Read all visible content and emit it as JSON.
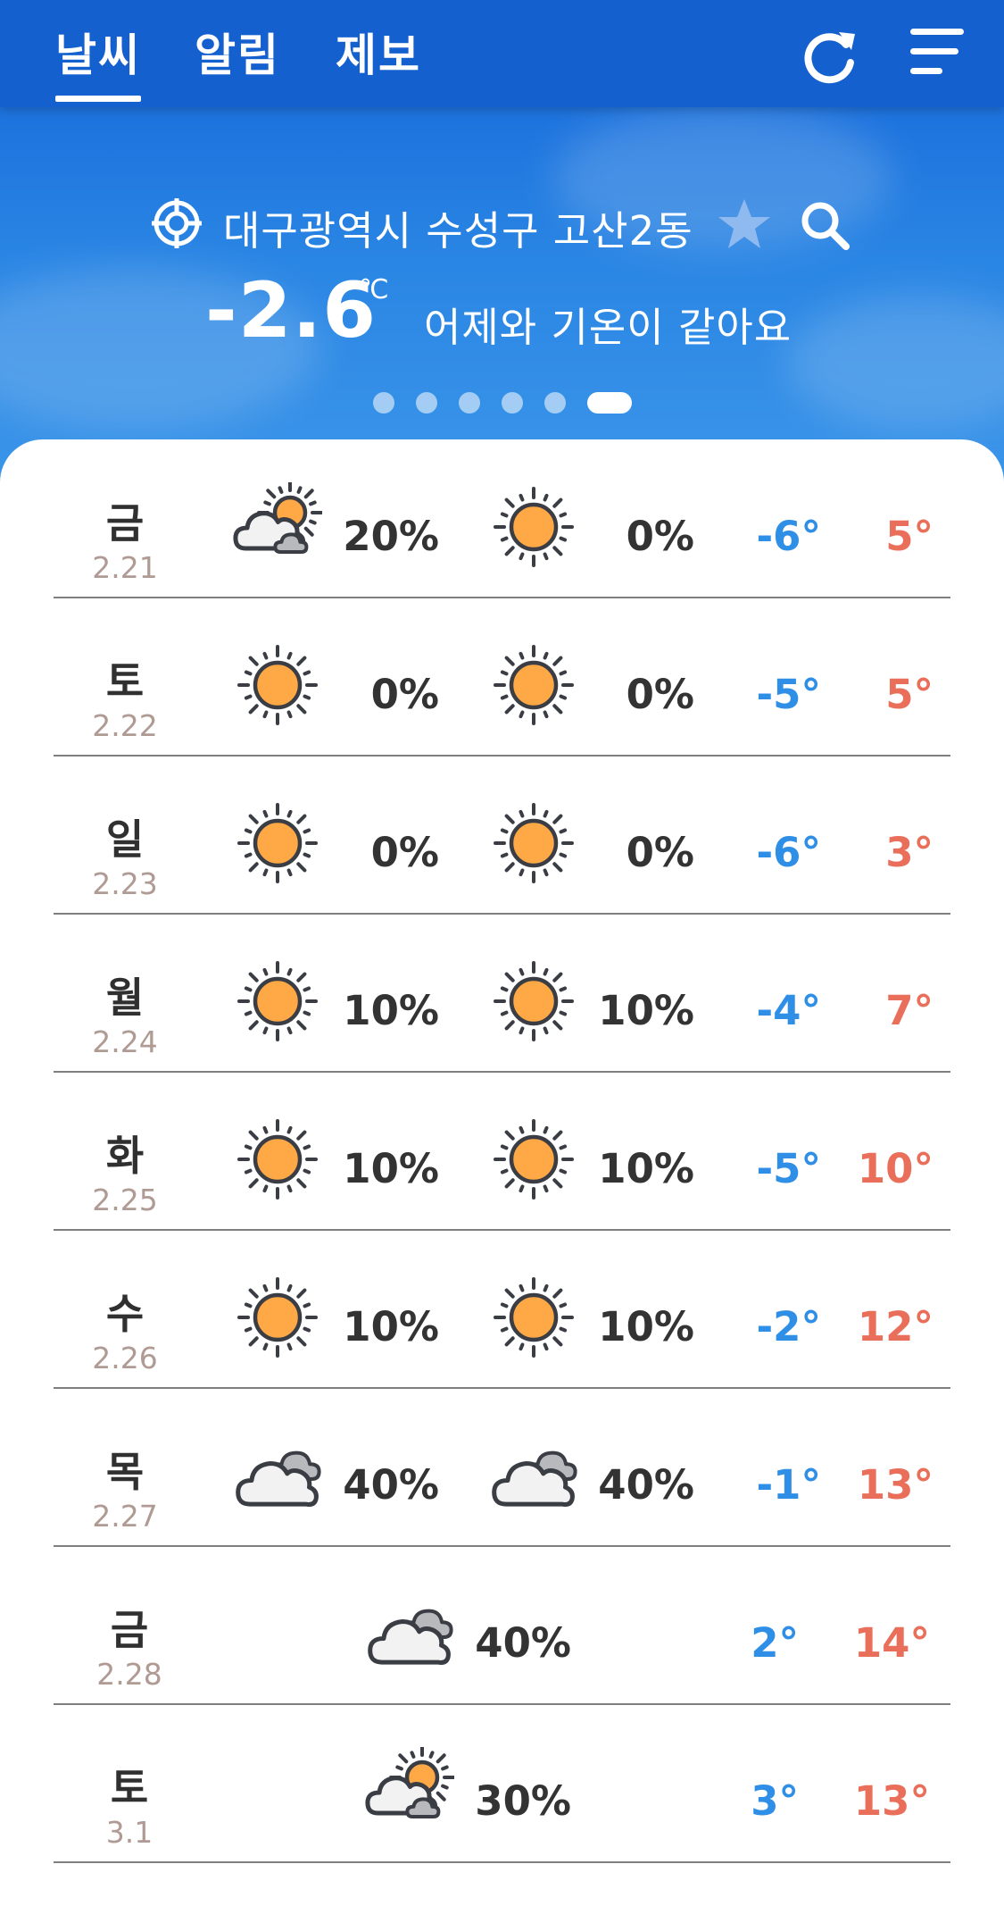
{
  "tabs": [
    {
      "label": "날씨",
      "active": true
    },
    {
      "label": "알림",
      "active": false
    },
    {
      "label": "제보",
      "active": false
    }
  ],
  "location": {
    "name": "대구광역시 수성구 고산2동"
  },
  "current": {
    "temperature": "-2.6",
    "unit": "℃",
    "comparison": "어제와 기온이 같아요"
  },
  "pager": {
    "count": 6,
    "active_index": 5
  },
  "icons": {
    "refresh": "refresh-icon",
    "menu": "menu-icon",
    "location": "location-target-icon",
    "favorite": "star-icon",
    "search": "search-icon",
    "sunny": "sun-icon",
    "cloudy": "cloud-icon",
    "partly_cloudy": "partly-cloudy-icon"
  },
  "colors": {
    "header": "#1560cf",
    "sky": "#2a86e4",
    "min_temp": "#2f8fe6",
    "max_temp": "#ea6f5b",
    "date": "#b09b94",
    "sun": "#ffa846"
  },
  "forecast": [
    {
      "day": "금",
      "date": "2.21",
      "am_icon": "partly_cloudy",
      "am_rain": "20%",
      "pm_icon": "sunny",
      "pm_rain": "0%",
      "min": "-6°",
      "max": "5°"
    },
    {
      "day": "토",
      "date": "2.22",
      "am_icon": "sunny",
      "am_rain": "0%",
      "pm_icon": "sunny",
      "pm_rain": "0%",
      "min": "-5°",
      "max": "5°"
    },
    {
      "day": "일",
      "date": "2.23",
      "am_icon": "sunny",
      "am_rain": "0%",
      "pm_icon": "sunny",
      "pm_rain": "0%",
      "min": "-6°",
      "max": "3°"
    },
    {
      "day": "월",
      "date": "2.24",
      "am_icon": "sunny",
      "am_rain": "10%",
      "pm_icon": "sunny",
      "pm_rain": "10%",
      "min": "-4°",
      "max": "7°"
    },
    {
      "day": "화",
      "date": "2.25",
      "am_icon": "sunny",
      "am_rain": "10%",
      "pm_icon": "sunny",
      "pm_rain": "10%",
      "min": "-5°",
      "max": "10°"
    },
    {
      "day": "수",
      "date": "2.26",
      "am_icon": "sunny",
      "am_rain": "10%",
      "pm_icon": "sunny",
      "pm_rain": "10%",
      "min": "-2°",
      "max": "12°"
    },
    {
      "day": "목",
      "date": "2.27",
      "am_icon": "cloudy",
      "am_rain": "40%",
      "pm_icon": "cloudy",
      "pm_rain": "40%",
      "min": "-1°",
      "max": "13°"
    },
    {
      "day": "금",
      "date": "2.28",
      "icon": "cloudy",
      "rain": "40%",
      "min": "2°",
      "max": "14°"
    },
    {
      "day": "토",
      "date": "3.1",
      "icon": "partly_cloudy",
      "rain": "30%",
      "min": "3°",
      "max": "13°"
    }
  ]
}
